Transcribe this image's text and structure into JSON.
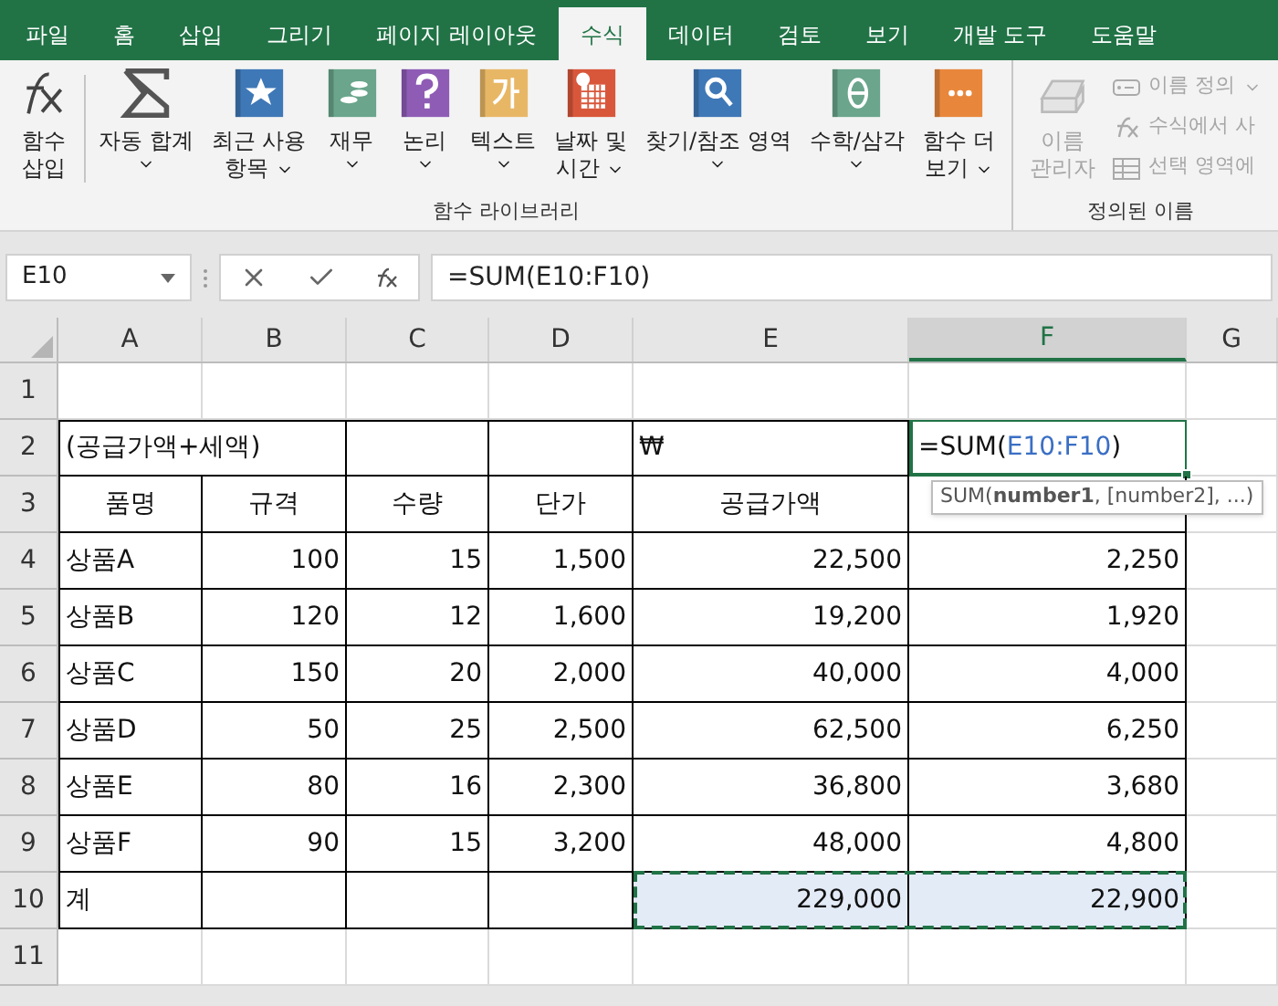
{
  "tabs": [
    {
      "label": "파일",
      "selected": false
    },
    {
      "label": "홈",
      "selected": false
    },
    {
      "label": "삽입",
      "selected": false
    },
    {
      "label": "그리기",
      "selected": false
    },
    {
      "label": "페이지 레이아웃",
      "selected": false
    },
    {
      "label": "수식",
      "selected": true
    },
    {
      "label": "데이터",
      "selected": false
    },
    {
      "label": "검토",
      "selected": false
    },
    {
      "label": "보기",
      "selected": false
    },
    {
      "label": "개발 도구",
      "selected": false
    },
    {
      "label": "도움말",
      "selected": false
    }
  ],
  "ribbon": {
    "groups": [
      {
        "label": "함수 라이브러리",
        "buttons": [
          {
            "kind": "fx",
            "lines": [
              "함수",
              "삽입"
            ],
            "dropdown": false
          },
          {
            "kind": "sigma",
            "lines": [
              "자동 합계"
            ],
            "dropdown": true
          },
          {
            "kind": "star",
            "lines": [
              "최근 사용",
              "항목"
            ],
            "dropdown": true
          },
          {
            "kind": "coins",
            "lines": [
              "재무"
            ],
            "dropdown": true
          },
          {
            "kind": "question",
            "lines": [
              "논리"
            ],
            "dropdown": true
          },
          {
            "kind": "text",
            "lines": [
              "텍스트"
            ],
            "dropdown": true
          },
          {
            "kind": "calendar",
            "lines": [
              "날짜 및",
              "시간"
            ],
            "dropdown": true
          },
          {
            "kind": "search",
            "lines": [
              "찾기/참조 영역"
            ],
            "dropdown": true
          },
          {
            "kind": "theta",
            "lines": [
              "수학/삼각"
            ],
            "dropdown": true
          },
          {
            "kind": "more",
            "lines": [
              "함수 더",
              "보기"
            ],
            "dropdown": true
          }
        ]
      },
      {
        "label": "정의된 이름",
        "buttons": [
          {
            "kind": "names",
            "lines": [
              "이름",
              "관리자"
            ],
            "dropdown": false,
            "disabled": true
          }
        ],
        "small_items": [
          {
            "kind": "tag",
            "label": "이름 정의",
            "dropdown": true,
            "disabled": true
          },
          {
            "kind": "fx",
            "label": "수식에서 사",
            "dropdown": false,
            "disabled": true
          },
          {
            "kind": "grid",
            "label": "선택 영역에",
            "dropdown": false,
            "disabled": true
          }
        ]
      }
    ]
  },
  "formula_bar": {
    "name_box": "E10",
    "formula": "=SUM(E10:F10)"
  },
  "columns": [
    {
      "label": "A",
      "selected": false
    },
    {
      "label": "B",
      "selected": false
    },
    {
      "label": "C",
      "selected": false
    },
    {
      "label": "D",
      "selected": false
    },
    {
      "label": "E",
      "selected": false
    },
    {
      "label": "F",
      "selected": true
    },
    {
      "label": "G",
      "selected": false
    }
  ],
  "rows": [
    {
      "label": "1",
      "cells": []
    },
    {
      "label": "2",
      "cells": [
        {
          "kind": "text",
          "text": "(공급가액+세액)"
        },
        {
          "kind": "merged"
        },
        {
          "kind": "empty"
        },
        {
          "kind": "empty"
        },
        {
          "kind": "text",
          "text": "₩"
        },
        {
          "kind": "editing",
          "formula_start": "=SUM(",
          "formula_ref": "E10:F10",
          "formula_end": ")"
        }
      ]
    },
    {
      "label": "3",
      "cells": [
        {
          "kind": "header",
          "text": "품명"
        },
        {
          "kind": "header",
          "text": "규격"
        },
        {
          "kind": "header",
          "text": "수량"
        },
        {
          "kind": "header",
          "text": "단가"
        },
        {
          "kind": "header",
          "text": "공급가액"
        },
        {
          "kind": "empty"
        }
      ]
    },
    {
      "label": "4",
      "cells": [
        {
          "kind": "text",
          "text": "상품A"
        },
        {
          "kind": "number",
          "text": "100"
        },
        {
          "kind": "number",
          "text": "15"
        },
        {
          "kind": "number",
          "text": "1,500"
        },
        {
          "kind": "number",
          "text": "22,500"
        },
        {
          "kind": "number",
          "text": "2,250"
        }
      ]
    },
    {
      "label": "5",
      "cells": [
        {
          "kind": "text",
          "text": "상품B"
        },
        {
          "kind": "number",
          "text": "120"
        },
        {
          "kind": "number",
          "text": "12"
        },
        {
          "kind": "number",
          "text": "1,600"
        },
        {
          "kind": "number",
          "text": "19,200"
        },
        {
          "kind": "number",
          "text": "1,920"
        }
      ]
    },
    {
      "label": "6",
      "cells": [
        {
          "kind": "text",
          "text": "상품C"
        },
        {
          "kind": "number",
          "text": "150"
        },
        {
          "kind": "number",
          "text": "20"
        },
        {
          "kind": "number",
          "text": "2,000"
        },
        {
          "kind": "number",
          "text": "40,000"
        },
        {
          "kind": "number",
          "text": "4,000"
        }
      ]
    },
    {
      "label": "7",
      "cells": [
        {
          "kind": "text",
          "text": "상품D"
        },
        {
          "kind": "number",
          "text": "50"
        },
        {
          "kind": "number",
          "text": "25"
        },
        {
          "kind": "number",
          "text": "2,500"
        },
        {
          "kind": "number",
          "text": "62,500"
        },
        {
          "kind": "number",
          "text": "6,250"
        }
      ]
    },
    {
      "label": "8",
      "cells": [
        {
          "kind": "text",
          "text": "상품E"
        },
        {
          "kind": "number",
          "text": "80"
        },
        {
          "kind": "number",
          "text": "16"
        },
        {
          "kind": "number",
          "text": "2,300"
        },
        {
          "kind": "number",
          "text": "36,800"
        },
        {
          "kind": "number",
          "text": "3,680"
        }
      ]
    },
    {
      "label": "9",
      "cells": [
        {
          "kind": "text",
          "text": "상품F"
        },
        {
          "kind": "number",
          "text": "90"
        },
        {
          "kind": "number",
          "text": "15"
        },
        {
          "kind": "number",
          "text": "3,200"
        },
        {
          "kind": "number",
          "text": "48,000"
        },
        {
          "kind": "number",
          "text": "4,800"
        }
      ]
    },
    {
      "label": "10",
      "cells": [
        {
          "kind": "text",
          "text": "계"
        },
        {
          "kind": "empty"
        },
        {
          "kind": "empty"
        },
        {
          "kind": "empty"
        },
        {
          "kind": "number",
          "text": "229,000",
          "selected": true
        },
        {
          "kind": "number",
          "text": "22,900",
          "selected": true
        }
      ]
    },
    {
      "label": "11",
      "cells": []
    }
  ],
  "tooltip": {
    "text": "SUM(**number1**, [number2], ...)"
  }
}
